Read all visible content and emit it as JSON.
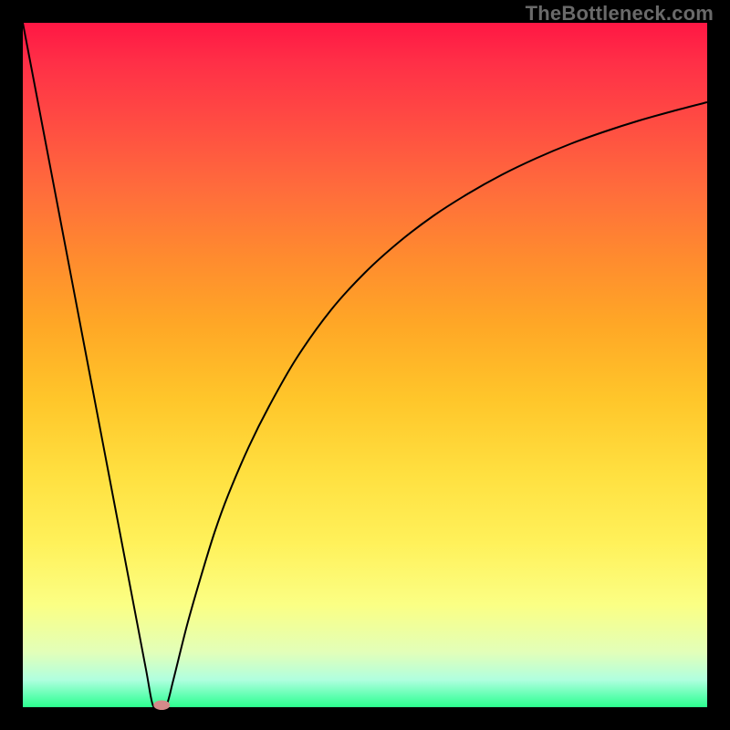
{
  "watermark": "TheBottleneck.com",
  "chart_data": {
    "type": "line",
    "title": "",
    "xlabel": "",
    "ylabel": "",
    "xlim": [
      0,
      100
    ],
    "ylim": [
      0,
      100
    ],
    "gradient_stops": [
      {
        "pos": 0,
        "color": "#ff1744"
      },
      {
        "pos": 6,
        "color": "#ff3047"
      },
      {
        "pos": 14,
        "color": "#ff4a43"
      },
      {
        "pos": 24,
        "color": "#ff6b3c"
      },
      {
        "pos": 34,
        "color": "#ff8a2f"
      },
      {
        "pos": 44,
        "color": "#ffa726"
      },
      {
        "pos": 55,
        "color": "#ffc62a"
      },
      {
        "pos": 66,
        "color": "#ffe040"
      },
      {
        "pos": 76,
        "color": "#fff15a"
      },
      {
        "pos": 85,
        "color": "#fbff84"
      },
      {
        "pos": 92,
        "color": "#e2ffb9"
      },
      {
        "pos": 96,
        "color": "#b0ffdf"
      },
      {
        "pos": 98.5,
        "color": "#5bffae"
      },
      {
        "pos": 100,
        "color": "#2bff8e"
      }
    ],
    "series": [
      {
        "name": "bottleneck-curve",
        "color": "#000000",
        "stroke_width": 2,
        "x": [
          0,
          2,
          4,
          6,
          8,
          10,
          12,
          14,
          16,
          18,
          19,
          20,
          21,
          22,
          24,
          26,
          28,
          30,
          33,
          36,
          40,
          45,
          50,
          55,
          60,
          65,
          70,
          75,
          80,
          85,
          90,
          95,
          100
        ],
        "y": [
          100,
          89.5,
          79,
          68.5,
          58,
          47.5,
          37,
          26.5,
          16,
          5.5,
          0.3,
          0,
          0.3,
          4,
          12,
          19,
          25.5,
          31,
          38,
          44,
          51,
          58,
          63.5,
          68,
          71.8,
          75,
          77.8,
          80.2,
          82.3,
          84.1,
          85.7,
          87.1,
          88.4
        ]
      }
    ],
    "marker": {
      "x": 20.3,
      "y": 0.3,
      "rx": 1.2,
      "ry": 0.7,
      "color": "#d48a8a"
    }
  }
}
